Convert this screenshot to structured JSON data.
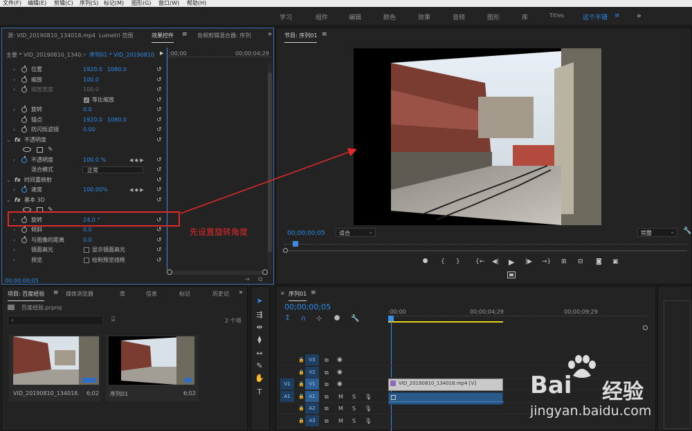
{
  "menu": [
    "文件(F)",
    "编辑(E)",
    "剪辑(C)",
    "序列(S)",
    "标记(M)",
    "图形(G)",
    "窗口(W)",
    "帮助(H)"
  ],
  "workspaces": [
    "学习",
    "组件",
    "编辑",
    "颜色",
    "效果",
    "音频",
    "图形",
    "库",
    "Titles",
    "这个不错"
  ],
  "workspace_menu_icon": "≡",
  "more_icon": "»",
  "effect_controls": {
    "tabs": [
      "源: VID_20190810_134018.mp4",
      "Lumetri 范围",
      "效果控件",
      "音频剪辑混合器: 序列"
    ],
    "master_label": "主要 * VID_20190810_1340…",
    "sequence_label": "序列01 * VID_20190810_…",
    "ruler_start": ";00;00",
    "ruler_end": "00;00;04;29",
    "properties": [
      {
        "name": "位置",
        "value": "1920.0",
        "value2": "1080.0",
        "chev": true,
        "watch": true
      },
      {
        "name": "缩放",
        "value": "100.0",
        "chev": true,
        "watch": true
      },
      {
        "name": "缩放宽度",
        "value": "100.0",
        "chev": true,
        "watch": true,
        "disabled": true
      },
      {
        "name": "等比缩放",
        "checkbox": true,
        "checked": true
      },
      {
        "name": "旋转",
        "value": "0.0",
        "chev": true,
        "watch": true
      },
      {
        "name": "锚点",
        "value": "1920.0",
        "value2": "1080.0",
        "chev": false,
        "watch": true
      },
      {
        "name": "防闪烁滤镜",
        "value": "0.00",
        "chev": true,
        "watch": true
      }
    ],
    "opacity_section": "不透明度",
    "opacity_rows": [
      {
        "name": "不透明度",
        "value": "100.0 %"
      },
      {
        "name": "混合模式",
        "dropdown": "正常"
      }
    ],
    "time_remap_section": "时间重映射",
    "time_remap_rows": [
      {
        "name": "速度",
        "value": "100.00%"
      }
    ],
    "basic3d_section": "基本 3D",
    "basic3d_rows": [
      {
        "name": "旋转",
        "value": "24.0 °",
        "highlight": true
      },
      {
        "name": "倾斜",
        "value": "0.0"
      },
      {
        "name": "与图像的距离",
        "value": "0.0"
      },
      {
        "name": "镜面高光",
        "checkbox_label": "显示镜面高光"
      },
      {
        "name": "预览",
        "checkbox_label": "绘制预览线框"
      }
    ],
    "timecode": "00;00;00;05"
  },
  "program_monitor": {
    "title": "节目: 序列01",
    "timecode": "00;00;00;05",
    "fit_label": "适合",
    "quality_label": "完整"
  },
  "project": {
    "tabs": [
      "项目: 百度经验",
      "媒体浏览器",
      "库",
      "信息",
      "标记",
      "历史记"
    ],
    "file": "百度经验.prproj",
    "item_count": "2 个项",
    "items": [
      {
        "name": "VID_20190810_134018.mp4",
        "duration": "6;02"
      },
      {
        "name": "序列01",
        "duration": "6;02"
      }
    ]
  },
  "timeline": {
    "title": "序列01",
    "timecode": "00;00;00;05",
    "ruler": [
      ":00;00",
      "00;00;04;29",
      "00;00;09;29"
    ],
    "tracks": [
      {
        "label": "V3",
        "type": "video"
      },
      {
        "label": "V2",
        "type": "video"
      },
      {
        "label": "V1",
        "type": "video",
        "source": "V1"
      },
      {
        "label": "A1",
        "type": "audio",
        "source": "A1"
      },
      {
        "label": "A2",
        "type": "audio"
      },
      {
        "label": "A3",
        "type": "audio"
      }
    ],
    "mute": "M",
    "solo": "S",
    "clip_label": "VID_20190810_134018.mp4 [V]"
  },
  "annotation": "先设置旋转角度",
  "watermark": {
    "brand": "Bai",
    "brand_cn": "经验",
    "url": "jingyan.baidu.com"
  },
  "colors": {
    "accent": "#2d8ceb",
    "annotation": "#e02a2a",
    "playhead": "#3b8ee6"
  }
}
